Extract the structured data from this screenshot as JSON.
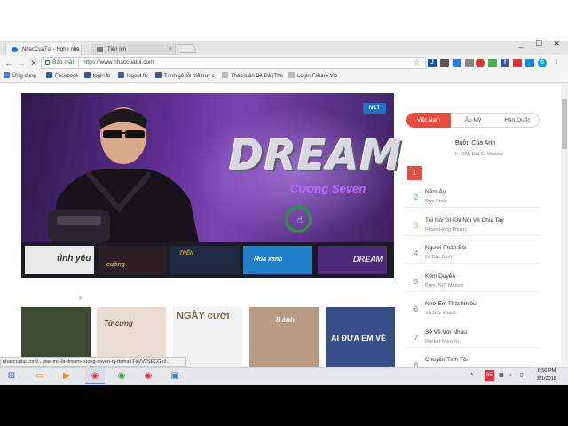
{
  "browser": {
    "tabs": [
      {
        "label": "NhacCuaTui - Nghe nhạ",
        "active": true
      },
      {
        "label": "Tiện ích",
        "active": false
      }
    ],
    "window_controls": [
      "_",
      "☐",
      "✕"
    ],
    "address": {
      "secure_label": "Bảo mật",
      "scheme": "https://",
      "host": "www.nhaccuatui.com"
    },
    "bookmarks": [
      {
        "label": "Ứng dụng",
        "color": "#4a7fd6"
      },
      {
        "label": "Facebook",
        "color": "#3b5998"
      },
      {
        "label": "login fb",
        "color": "#3b5998"
      },
      {
        "label": "logout fb",
        "color": "#3b5998"
      },
      {
        "label": "Trình gỡ lỗi mã truy c",
        "color": "#3b5998"
      },
      {
        "label": "Thảo luận Đề Bá (The",
        "color": "#999999"
      },
      {
        "label": "Login Fshare Vip",
        "color": "#888888"
      }
    ]
  },
  "banner": {
    "logo_text": "NCT",
    "title": "DREAM",
    "artist": "Cường Seven"
  },
  "thumbnails": [
    {
      "text": "tình yêu",
      "bg": "#eaeaea",
      "fg": "#333333"
    },
    {
      "text": "cuồng",
      "bg": "#2b1d22",
      "fg": "#d6b07a"
    },
    {
      "text": "TRÊN",
      "bg": "#1d2a40",
      "fg": "#c9a24b"
    },
    {
      "text": "Mùa xanh",
      "bg": "#1e80c8",
      "fg": "#ffffff"
    },
    {
      "text": "DREAM",
      "bg": "#4d2b7a",
      "fg": "#dddddd"
    }
  ],
  "albums": [
    {
      "text": "",
      "bg": "#3f4a33",
      "fg": "#eeeeee"
    },
    {
      "text": "Từ cưng",
      "bg": "#e9dcd0",
      "fg": "#6a4b3a"
    },
    {
      "text": "NGÀY cưới",
      "bg": "#f2f2f2",
      "fg": "#7a6a4a"
    },
    {
      "text": "8 ánh",
      "bg": "#b79b85",
      "fg": "#ffffff"
    },
    {
      "text": "AI ĐƯA EM VỀ",
      "bg": "#3a4f8a",
      "fg": "#ffffff"
    }
  ],
  "chart": {
    "tabs": [
      "Việt Nam",
      "Âu Mỹ",
      "Hàn Quốc"
    ],
    "top": {
      "rank": "1",
      "title": "Buồn Của Anh",
      "artist": "K-ICM, Đạt G, Masew"
    },
    "rows": [
      {
        "rank": "2",
        "title": "Nắm Ấy",
        "artist": "Đức Phúc",
        "rank_color": "#27a4c7"
      },
      {
        "rank": "3",
        "title": "Tôi Nói Gì Khi Nói Về Chia Tay",
        "artist": "Phạm Hồng Phước",
        "rank_color": "#f0a53a"
      },
      {
        "rank": "4",
        "title": "Người Phản Bội",
        "artist": "Lê Bảo Bình",
        "rank_color": "#888888"
      },
      {
        "rank": "5",
        "title": "Kém Duyên",
        "artist": "Rum, NIT, Masew",
        "rank_color": "#888888"
      },
      {
        "rank": "6",
        "title": "Nhớ Em Thật Nhiều",
        "artist": "Vũ Duy Khánh",
        "rank_color": "#888888"
      },
      {
        "rank": "7",
        "title": "Sẽ Về Với Nhau",
        "artist": "Rocker Nguyễn",
        "rank_color": "#888888"
      },
      {
        "rank": "8",
        "title": "Chuyện Tình Tôi",
        "artist": "",
        "rank_color": "#888888"
      }
    ]
  },
  "status_url": "nhaccuatui.com/...giac-mo-la-dream-cuong-seven-dj-dsmall.FsVV2SECGe3...",
  "taskbar": {
    "tray_badge": "65",
    "time": "6:50 PM",
    "date": "8/1/2018"
  }
}
